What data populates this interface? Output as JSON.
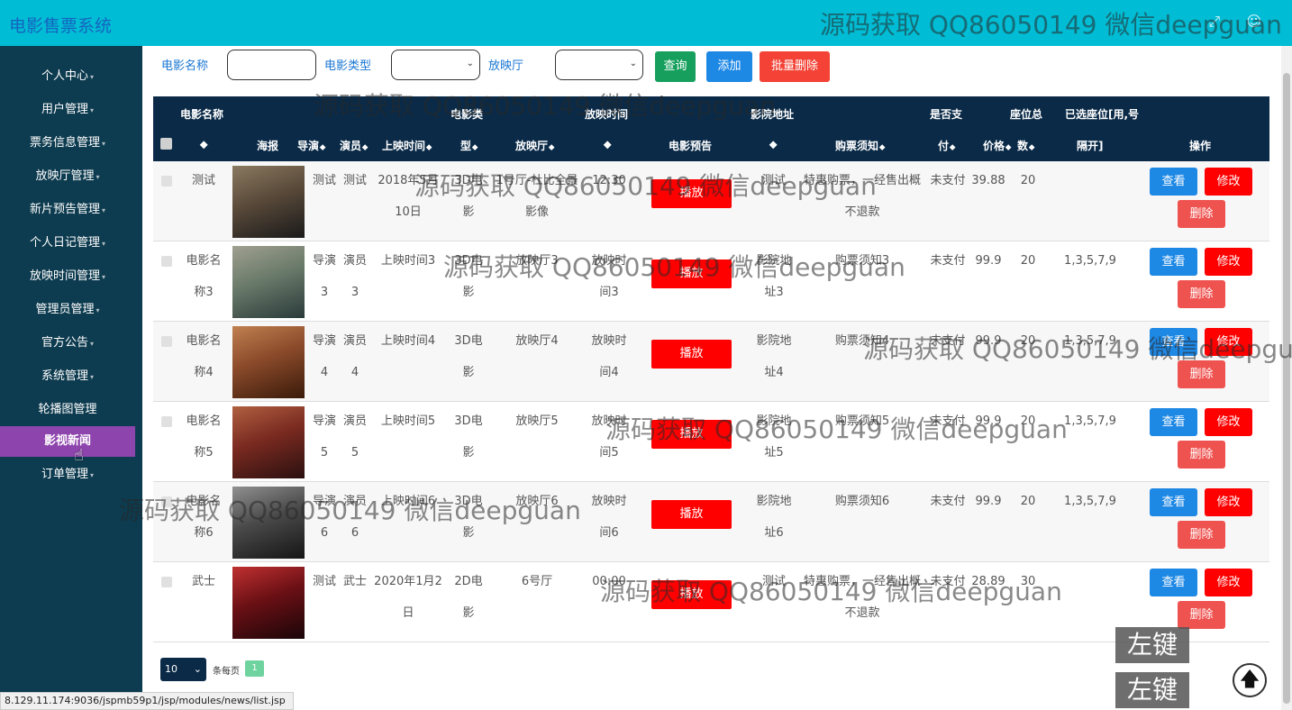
{
  "app": {
    "title": "电影售票系统",
    "fullscreen_icon": "fullscreen-icon",
    "user_icon": "user-icon"
  },
  "sidebar": {
    "items": [
      {
        "label": "个人中心",
        "has_caret": true
      },
      {
        "label": "用户管理",
        "has_caret": true
      },
      {
        "label": "票务信息管理",
        "has_caret": true
      },
      {
        "label": "放映厅管理",
        "has_caret": true
      },
      {
        "label": "新片预告管理",
        "has_caret": true
      },
      {
        "label": "个人日记管理",
        "has_caret": true
      },
      {
        "label": "放映时间管理",
        "has_caret": true
      },
      {
        "label": "管理员管理",
        "has_caret": true
      },
      {
        "label": "官方公告",
        "has_caret": true
      },
      {
        "label": "系统管理",
        "has_caret": true
      },
      {
        "label": "轮播图管理",
        "has_caret": false
      },
      {
        "label": "影视新闻",
        "has_caret": false,
        "active": true
      },
      {
        "label": "订单管理",
        "has_caret": true
      }
    ]
  },
  "filters": {
    "name_label": "电影名称",
    "name_value": "",
    "type_label": "电影类型",
    "type_value": "",
    "hall_label": "放映厅",
    "hall_value": "",
    "query_btn": "查询",
    "add_btn": "添加",
    "batch_delete_btn": "批量删除"
  },
  "table": {
    "h_name": "电影名称",
    "h_type1": "电影类",
    "h_time1": "放映时间",
    "h_addr1": "影院地址",
    "h_pay1": "是否支",
    "h_seat1": "座位总",
    "h_sel1": "已选座位[用,号",
    "h_poster": "海报",
    "h_director": "导演",
    "h_actor": "演员",
    "h_release": "上映时间",
    "h_type2": "型",
    "h_hall": "放映厅",
    "h_trailer": "电影预告",
    "h_notice": "购票须知",
    "h_pay2": "付",
    "h_price": "价格",
    "h_seat2": "数",
    "h_sel2": "隔开]",
    "h_op": "操作",
    "rows": [
      {
        "name1": "测试",
        "name2": "",
        "director1": "测试",
        "director2": "",
        "actor1": "测试",
        "actor2": "",
        "release1": "2018年5月",
        "release2": "10日",
        "type1": "3D电",
        "type2": "影",
        "hall1": "1号厅-杜比全景",
        "hall2": "影像",
        "time1": "12:30",
        "time2": "",
        "play": "播放",
        "addr1": "测试",
        "addr2": "",
        "notice1": "特惠购票，一经售出概",
        "notice2": "不退款",
        "paid": "未支付",
        "price": "39.88",
        "seats": "20",
        "selected": "",
        "view": "查看",
        "edit": "修改",
        "del": "删除",
        "poster_colors": [
          "#1a1a1a",
          "#5a4a3a",
          "#8a7a60"
        ]
      },
      {
        "name1": "电影名",
        "name2": "称3",
        "director1": "导演",
        "director2": "3",
        "actor1": "演员",
        "actor2": "3",
        "release1": "上映时间3",
        "release2": "",
        "type1": "3D电",
        "type2": "影",
        "hall1": "放映厅3",
        "hall2": "",
        "time1": "放映时",
        "time2": "间3",
        "play": "播放",
        "addr1": "影院地",
        "addr2": "址3",
        "notice1": "购票须知3",
        "notice2": "",
        "paid": "未支付",
        "price": "99.9",
        "seats": "20",
        "selected": "1,3,5,7,9",
        "view": "查看",
        "edit": "修改",
        "del": "删除",
        "poster_colors": [
          "#2a3a3a",
          "#6a7a6a",
          "#a0a090"
        ]
      },
      {
        "name1": "电影名",
        "name2": "称4",
        "director1": "导演",
        "director2": "4",
        "actor1": "演员",
        "actor2": "4",
        "release1": "上映时间4",
        "release2": "",
        "type1": "3D电",
        "type2": "影",
        "hall1": "放映厅4",
        "hall2": "",
        "time1": "放映时",
        "time2": "间4",
        "play": "播放",
        "addr1": "影院地",
        "addr2": "址4",
        "notice1": "购票须知4",
        "notice2": "",
        "paid": "未支付",
        "price": "99.9",
        "seats": "20",
        "selected": "1,3,5,7,9",
        "view": "查看",
        "edit": "修改",
        "del": "删除",
        "poster_colors": [
          "#3a1a0a",
          "#8a4a2a",
          "#c08050"
        ]
      },
      {
        "name1": "电影名",
        "name2": "称5",
        "director1": "导演",
        "director2": "5",
        "actor1": "演员",
        "actor2": "5",
        "release1": "上映时间5",
        "release2": "",
        "type1": "3D电",
        "type2": "影",
        "hall1": "放映厅5",
        "hall2": "",
        "time1": "放映时",
        "time2": "间5",
        "play": "播放",
        "addr1": "影院地",
        "addr2": "址5",
        "notice1": "购票须知5",
        "notice2": "",
        "paid": "未支付",
        "price": "99.9",
        "seats": "20",
        "selected": "1,3,5,7,9",
        "view": "查看",
        "edit": "修改",
        "del": "删除",
        "poster_colors": [
          "#2a1010",
          "#7a2a20",
          "#b06040"
        ]
      },
      {
        "name1": "电影名",
        "name2": "称6",
        "director1": "导演",
        "director2": "6",
        "actor1": "演员",
        "actor2": "6",
        "release1": "上映时间6",
        "release2": "",
        "type1": "3D电",
        "type2": "影",
        "hall1": "放映厅6",
        "hall2": "",
        "time1": "放映时",
        "time2": "间6",
        "play": "播放",
        "addr1": "影院地",
        "addr2": "址6",
        "notice1": "购票须知6",
        "notice2": "",
        "paid": "未支付",
        "price": "99.9",
        "seats": "20",
        "selected": "1,3,5,7,9",
        "view": "查看",
        "edit": "修改",
        "del": "删除",
        "poster_colors": [
          "#151515",
          "#4a4a4a",
          "#909090"
        ]
      },
      {
        "name1": "武士",
        "name2": "",
        "director1": "测试",
        "director2": "",
        "actor1": "武士",
        "actor2": "",
        "release1": "2020年1月2",
        "release2": "日",
        "type1": "2D电",
        "type2": "影",
        "hall1": "6号厅",
        "hall2": "",
        "time1": "00:00",
        "time2": "",
        "play": "播放",
        "addr1": "测试",
        "addr2": "",
        "notice1": "特惠购票，一经售出概",
        "notice2": "不退款",
        "paid": "未支付",
        "price": "28.89",
        "seats": "30",
        "selected": "",
        "view": "查看",
        "edit": "修改",
        "del": "删除",
        "poster_colors": [
          "#1a0508",
          "#6a1015",
          "#c03030"
        ]
      }
    ]
  },
  "pager": {
    "page_size": "10",
    "per_page_text": "条每页",
    "current_page": "1"
  },
  "status_url": "8.129.11.174:9036/jspmb59p1/jsp/modules/news/list.jsp",
  "overlays": {
    "watermark": "源码获取 QQ86050149 微信deepguan",
    "mouse_badge_1": "左键",
    "mouse_badge_2": "左键",
    "scroll_top_icon": "arrow-up-icon"
  }
}
